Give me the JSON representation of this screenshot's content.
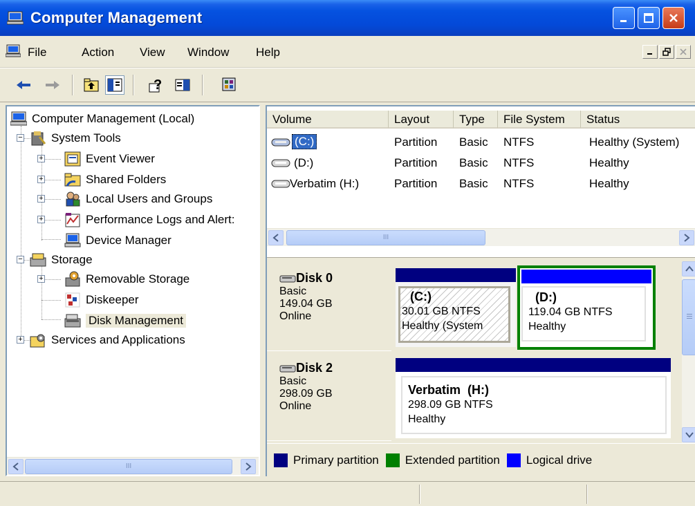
{
  "window": {
    "title": "Computer Management"
  },
  "menu": {
    "items": [
      "File",
      "Action",
      "View",
      "Window",
      "Help"
    ]
  },
  "toolbar": {
    "icons": [
      "back-arrow-icon",
      "forward-arrow-icon",
      "up-folder-icon",
      "show-hide-tree-icon",
      "help-icon",
      "action-pane-icon",
      "properties-icon"
    ]
  },
  "tree": {
    "root": "Computer Management (Local)",
    "system_tools": "System Tools",
    "event_viewer": "Event Viewer",
    "shared_folders": "Shared Folders",
    "local_users": "Local Users and Groups",
    "perf_logs": "Performance Logs and Alert:",
    "device_manager": "Device Manager",
    "storage": "Storage",
    "removable_storage": "Removable Storage",
    "diskeeper": "Diskeeper",
    "disk_management": "Disk Management",
    "services": "Services and Applications"
  },
  "volume_list": {
    "columns": [
      "Volume",
      "Layout",
      "Type",
      "File System",
      "Status"
    ],
    "rows": [
      {
        "volume": "(C:)",
        "layout": "Partition",
        "type": "Basic",
        "fs": "NTFS",
        "status": "Healthy (System)"
      },
      {
        "volume": "(D:)",
        "layout": "Partition",
        "type": "Basic",
        "fs": "NTFS",
        "status": "Healthy"
      },
      {
        "volume": "Verbatim (H:)",
        "layout": "Partition",
        "type": "Basic",
        "fs": "NTFS",
        "status": "Healthy"
      }
    ]
  },
  "disks": [
    {
      "name": "Disk 0",
      "type": "Basic",
      "size": "149.04 GB",
      "state": "Online",
      "partitions": [
        {
          "label": "(C:)",
          "size": "30.01 GB NTFS",
          "status": "Healthy (System"
        },
        {
          "label": "(D:)",
          "size": "119.04 GB NTFS",
          "status": "Healthy"
        }
      ]
    },
    {
      "name": "Disk 2",
      "type": "Basic",
      "size": "298.09 GB",
      "state": "Online",
      "partitions": [
        {
          "label": "Verbatim  (H:)",
          "size": "298.09 GB NTFS",
          "status": "Healthy"
        }
      ]
    }
  ],
  "legend": {
    "primary": "Primary partition",
    "extended": "Extended partition",
    "logical": "Logical drive",
    "colors": {
      "primary": "#000080",
      "extended": "#008000",
      "logical": "#0000ff"
    }
  },
  "scroll_glyph": "III"
}
